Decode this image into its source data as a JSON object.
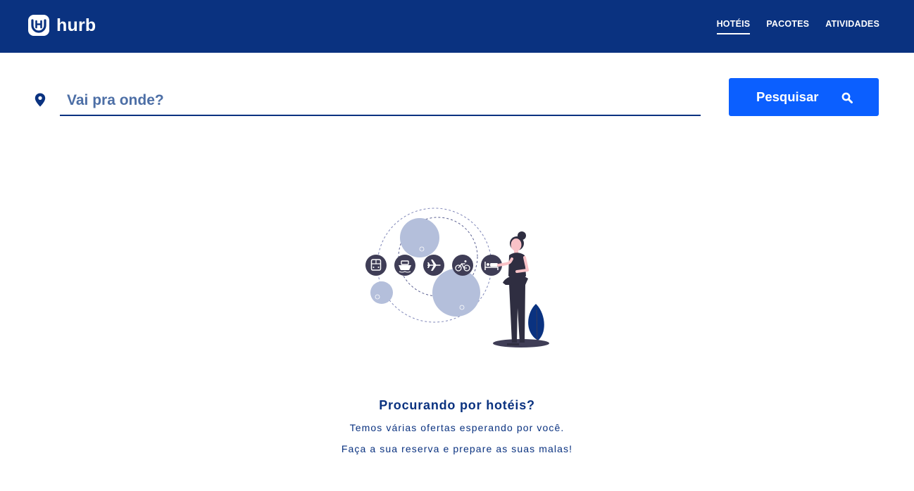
{
  "brand": {
    "name": "hurb",
    "header_color": "#0a3280",
    "accent_color": "#0b5fff"
  },
  "nav": {
    "items": [
      {
        "label": "HOTÉIS",
        "active": true
      },
      {
        "label": "PACOTES",
        "active": false
      },
      {
        "label": "ATIVIDADES",
        "active": false
      }
    ]
  },
  "search": {
    "icon": "map-pin-icon",
    "placeholder": "Vai pra onde?",
    "value": "",
    "button_label": "Pesquisar",
    "button_icon": "search-icon"
  },
  "illustration": {
    "icons": [
      "bus-icon",
      "ship-icon",
      "airplane-icon",
      "bicycle-icon",
      "bed-icon"
    ]
  },
  "empty_state": {
    "title": "Procurando por hotéis?",
    "line1": "Temos várias ofertas esperando por você.",
    "line2": "Faça a sua reserva e prepare as suas malas!"
  }
}
